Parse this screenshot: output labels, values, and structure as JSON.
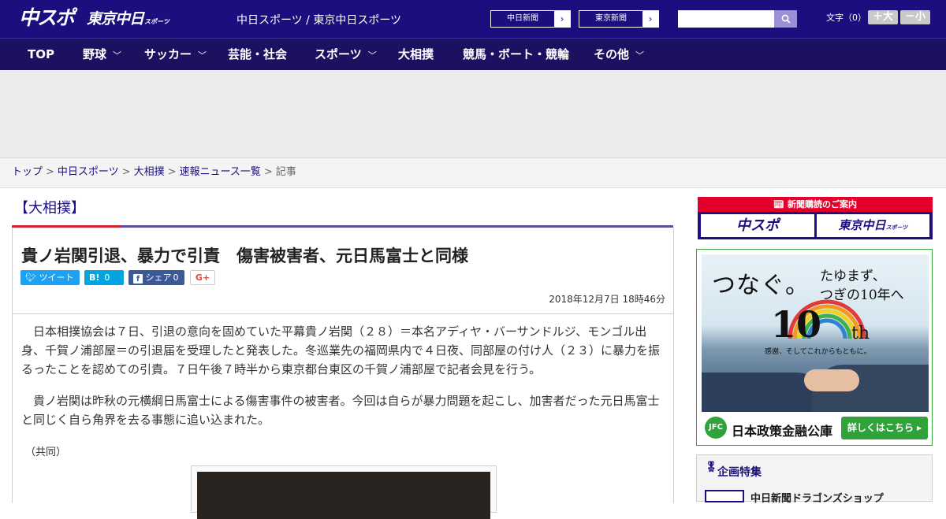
{
  "header": {
    "logo_chuspo": "中スポ",
    "logo_tokyo": "東京中日",
    "logo_tokyo_small": "スポーツ",
    "tagline": "中日スポーツ / 東京中日スポーツ",
    "newspaper_links": [
      "中日新聞",
      "東京新聞"
    ],
    "search": {
      "placeholder": "",
      "button_icon": "search-icon"
    },
    "font_size": {
      "label": "文字（0）",
      "bigger": "＋大",
      "smaller": "－小"
    }
  },
  "nav": {
    "items": [
      {
        "label": "TOP",
        "has_menu": false
      },
      {
        "label": "野球",
        "has_menu": true
      },
      {
        "label": "サッカー",
        "has_menu": true
      },
      {
        "label": "芸能・社会",
        "has_menu": false
      },
      {
        "label": "スポーツ",
        "has_menu": true
      },
      {
        "label": "大相撲",
        "has_menu": false
      },
      {
        "label": "競馬・ボート・競輪",
        "has_menu": false
      },
      {
        "label": "その他",
        "has_menu": true
      }
    ]
  },
  "breadcrumb": [
    "トップ",
    "中日スポーツ",
    "大相撲",
    "速報ニュース一覧",
    "記事"
  ],
  "article": {
    "category": "【大相撲】",
    "headline": "貴ノ岩関引退、暴力で引責　傷害被害者、元日馬富士と同様",
    "share": {
      "tweet": "ツイート",
      "hatena_count": "0",
      "facebook_label": "シェア",
      "facebook_count": "0",
      "gplus": "G+"
    },
    "date": "2018年12月7日 18時46分",
    "paragraphs": [
      "　日本相撲協会は７日、引退の意向を固めていた平幕貴ノ岩関（２８）＝本名アディヤ・バーサンドルジ、モンゴル出身、千賀ノ浦部屋＝の引退届を受理したと発表した。冬巡業先の福岡県内で４日夜、同部屋の付け人（２３）に暴力を振るったことを認めての引責。７日午後７時半から東京都台東区の千賀ノ浦部屋で記者会見を行う。",
      "　貴ノ岩関は昨秋の元横綱日馬富士による傷害事件の被害者。今回は自らが暴力問題を起こし、加害者だった元日馬富士と同じく自ら角界を去る事態に追い込まれた。"
    ],
    "credit": "（共同）"
  },
  "sidebar": {
    "subscribe": {
      "heading": "新聞購読のご案内",
      "logos": [
        "中スポ",
        "東京中日"
      ],
      "logo_small": "スポーツ"
    },
    "jfc_ad": {
      "headline": "つなぐ。",
      "sub": [
        "たゆまず、",
        "つぎの10年へ"
      ],
      "number": "10",
      "suffix": "th",
      "thanks": "感謝、そしてこれからもともに。",
      "logo": "JFC",
      "org": "日本政策金融公庫",
      "cta": "詳しくはこちら ▸"
    },
    "feature": {
      "title": "企画特集",
      "first_item": "中日新聞ドラゴンズショップ"
    }
  }
}
